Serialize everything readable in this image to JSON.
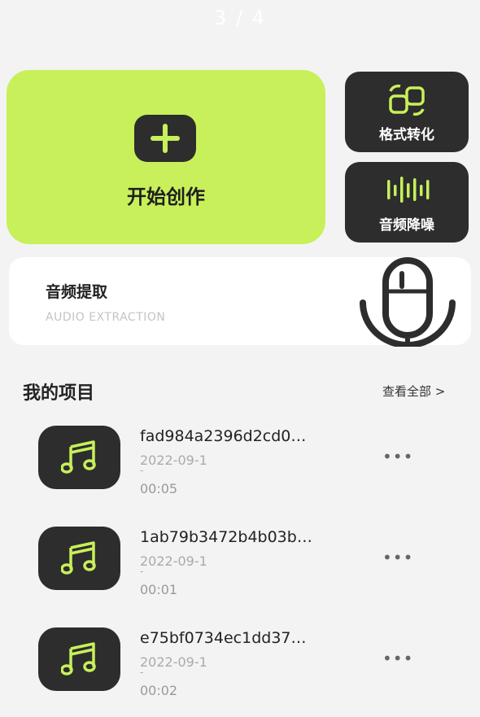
{
  "page_indicator": "3 / 4",
  "create": {
    "label": "开始创作"
  },
  "side_tools": [
    {
      "label": "格式转化",
      "icon": "format-convert-icon"
    },
    {
      "label": "音频降噪",
      "icon": "waveform-icon"
    }
  ],
  "extraction": {
    "title": "音频提取",
    "subtitle": "AUDIO EXTRACTION"
  },
  "projects_section": {
    "title": "我的项目",
    "view_all": "查看全部 >"
  },
  "projects": [
    {
      "name": "fad984a2396d2cd0…",
      "date": "2022-09-1",
      "dash": "-",
      "duration": "00:05",
      "more": "•••"
    },
    {
      "name": "1ab79b3472b4b03b…",
      "date": "2022-09-1",
      "dash": "-",
      "duration": "00:01",
      "more": "•••"
    },
    {
      "name": "e75bf0734ec1dd37…",
      "date": "2022-09-1",
      "dash": "-",
      "duration": "00:02",
      "more": "•••"
    }
  ],
  "colors": {
    "accent": "#c8f05a",
    "dark": "#2d2d2d",
    "background": "#f3f3f3"
  }
}
